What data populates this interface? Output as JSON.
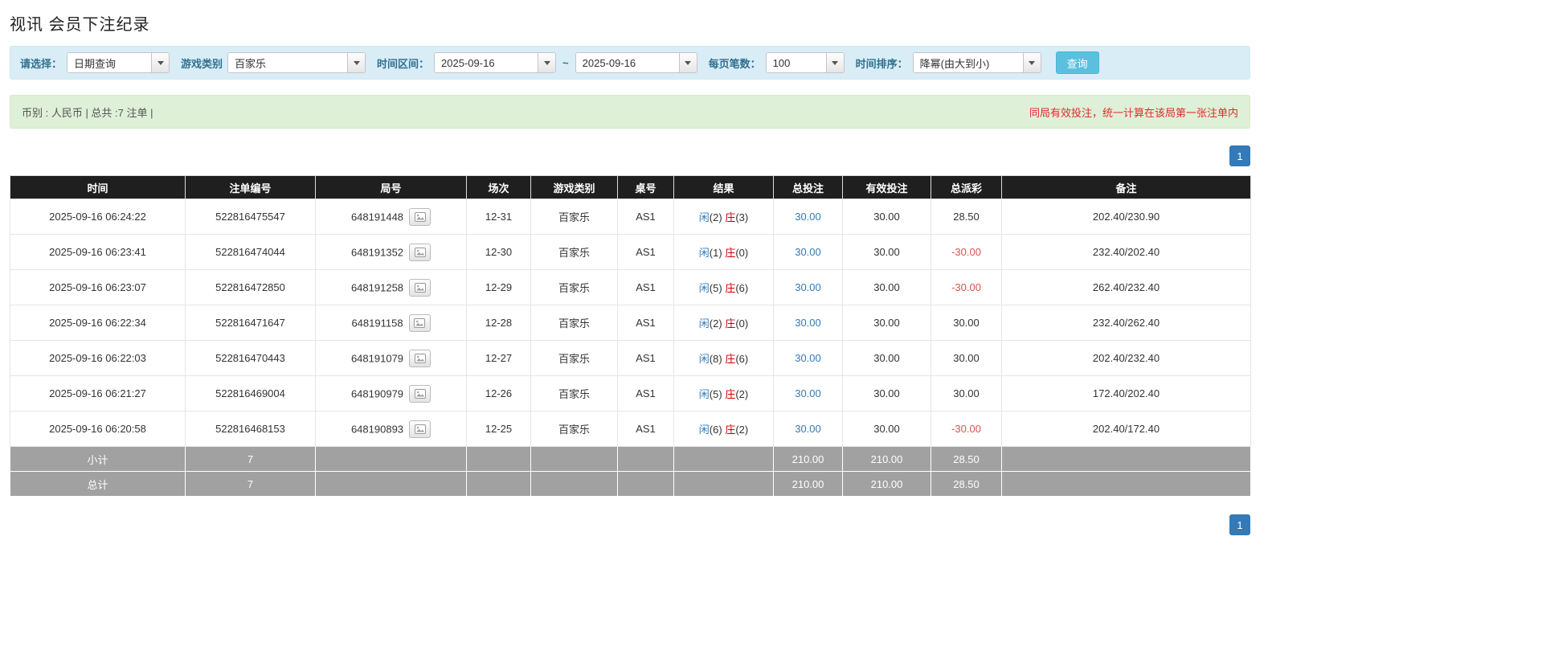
{
  "colors": {
    "accent_blue": "#337ab7",
    "player_blue": "#337ab7",
    "banker_red": "#cc0000",
    "negative_red": "#d9534f",
    "filter_bar_bg": "#d9edf7",
    "summary_bar_bg": "#dff0d8",
    "table_header_bg": "#1f1f1f",
    "footer_row_bg": "#a1a1a1",
    "search_button_bg": "#5bc0de"
  },
  "page": {
    "title": "视讯 会员下注纪录"
  },
  "filters": {
    "select_label": "请选择：",
    "select_value": "日期查询",
    "game_type_label": "游戏类别",
    "game_type_value": "百家乐",
    "time_range_label": "时间区间：",
    "date_from": "2025-09-16",
    "date_to": "2025-09-16",
    "range_separator": "~",
    "per_page_label": "每页笔数：",
    "per_page_value": "100",
    "sort_label": "时间排序：",
    "sort_value": "降幂(由大到小)",
    "search_button": "查询"
  },
  "summary": {
    "left": "币别 : 人民币 | 总共 :7 注单 |",
    "right": "同局有效投注，统一计算在该局第一张注单内"
  },
  "pagination": {
    "page": "1"
  },
  "table": {
    "headers": [
      "时间",
      "注单编号",
      "局号",
      "场次",
      "游戏类别",
      "桌号",
      "结果",
      "总投注",
      "有效投注",
      "总派彩",
      "备注"
    ],
    "rows": [
      {
        "time": "2025-09-16 06:24:22",
        "bet_id": "522816475547",
        "round_id": "648191448",
        "session": "12-31",
        "game": "百家乐",
        "table_no": "AS1",
        "player": "闲",
        "player_score": "(2)",
        "banker": "庄",
        "banker_score": "(3)",
        "total_bet": "30.00",
        "valid_bet": "30.00",
        "payout": "28.50",
        "note": "202.40/230.90"
      },
      {
        "time": "2025-09-16 06:23:41",
        "bet_id": "522816474044",
        "round_id": "648191352",
        "session": "12-30",
        "game": "百家乐",
        "table_no": "AS1",
        "player": "闲",
        "player_score": "(1)",
        "banker": "庄",
        "banker_score": "(0)",
        "total_bet": "30.00",
        "valid_bet": "30.00",
        "payout": "-30.00",
        "note": "232.40/202.40"
      },
      {
        "time": "2025-09-16 06:23:07",
        "bet_id": "522816472850",
        "round_id": "648191258",
        "session": "12-29",
        "game": "百家乐",
        "table_no": "AS1",
        "player": "闲",
        "player_score": "(5)",
        "banker": "庄",
        "banker_score": "(6)",
        "total_bet": "30.00",
        "valid_bet": "30.00",
        "payout": "-30.00",
        "note": "262.40/232.40"
      },
      {
        "time": "2025-09-16 06:22:34",
        "bet_id": "522816471647",
        "round_id": "648191158",
        "session": "12-28",
        "game": "百家乐",
        "table_no": "AS1",
        "player": "闲",
        "player_score": "(2)",
        "banker": "庄",
        "banker_score": "(0)",
        "total_bet": "30.00",
        "valid_bet": "30.00",
        "payout": "30.00",
        "note": "232.40/262.40"
      },
      {
        "time": "2025-09-16 06:22:03",
        "bet_id": "522816470443",
        "round_id": "648191079",
        "session": "12-27",
        "game": "百家乐",
        "table_no": "AS1",
        "player": "闲",
        "player_score": "(8)",
        "banker": "庄",
        "banker_score": "(6)",
        "total_bet": "30.00",
        "valid_bet": "30.00",
        "payout": "30.00",
        "note": "202.40/232.40"
      },
      {
        "time": "2025-09-16 06:21:27",
        "bet_id": "522816469004",
        "round_id": "648190979",
        "session": "12-26",
        "game": "百家乐",
        "table_no": "AS1",
        "player": "闲",
        "player_score": "(5)",
        "banker": "庄",
        "banker_score": "(2)",
        "total_bet": "30.00",
        "valid_bet": "30.00",
        "payout": "30.00",
        "note": "172.40/202.40"
      },
      {
        "time": "2025-09-16 06:20:58",
        "bet_id": "522816468153",
        "round_id": "648190893",
        "session": "12-25",
        "game": "百家乐",
        "table_no": "AS1",
        "player": "闲",
        "player_score": "(6)",
        "banker": "庄",
        "banker_score": "(2)",
        "total_bet": "30.00",
        "valid_bet": "30.00",
        "payout": "-30.00",
        "note": "202.40/172.40"
      }
    ],
    "subtotal": {
      "label": "小计",
      "count": "7",
      "total_bet": "210.00",
      "valid_bet": "210.00",
      "payout": "28.50"
    },
    "total": {
      "label": "总计",
      "count": "7",
      "total_bet": "210.00",
      "valid_bet": "210.00",
      "payout": "28.50"
    }
  }
}
